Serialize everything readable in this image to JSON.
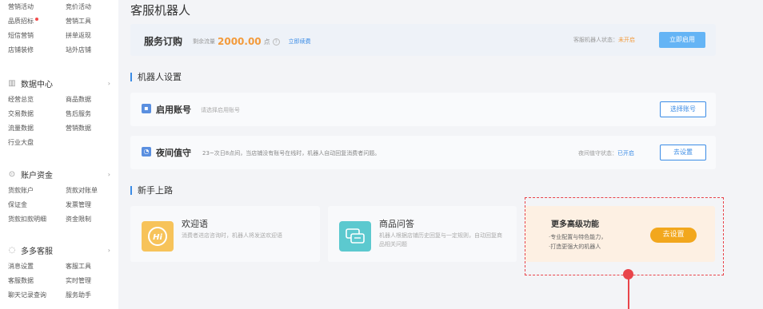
{
  "sidebar": {
    "top_items": [
      "营销活动",
      "竞价活动",
      "品质招标",
      "营销工具",
      "短信营销",
      "拼单返现",
      "店铺装修",
      "站外店铺"
    ],
    "sections": [
      {
        "title": "数据中心",
        "items": [
          "经营总览",
          "商品数据",
          "交易数据",
          "售后服务",
          "流量数据",
          "营销数据",
          "行业大盘",
          ""
        ]
      },
      {
        "title": "账户资金",
        "items": [
          "货款账户",
          "货款对账单",
          "保证金",
          "发票管理",
          "货款扣款明细",
          "资金限制"
        ]
      },
      {
        "title": "多多客服",
        "items": [
          "消息设置",
          "客服工具",
          "客服数据",
          "实时管理",
          "聊天记录查询",
          "服务助手"
        ]
      }
    ]
  },
  "page_title": "客服机器人",
  "subscription": {
    "label": "服务订购",
    "remaining_label": "剩余流量",
    "amount": "2000.00",
    "unit": "点",
    "renew_link": "立即续费",
    "status_label": "客服机器人状态：",
    "status_value": "未开启",
    "enable_button": "立即启用"
  },
  "robot_settings": {
    "heading": "机器人设置",
    "account": {
      "title": "启用账号",
      "hint": "请选择启用账号",
      "button": "选择账号"
    },
    "night_shift": {
      "title": "夜间值守",
      "desc": "23~次日8点间，当店铺没有账号在线时，机器人自动回复消费者问题。",
      "status_label": "夜间值守状态：",
      "status_value": "已开启",
      "button": "去设置"
    }
  },
  "onboarding": {
    "heading": "新手上路",
    "cards": [
      {
        "title": "欢迎语",
        "desc": "消费者进店咨询时，机器人将发送欢迎语",
        "icon": "hi-chat-icon"
      },
      {
        "title": "商品问答",
        "desc": "机器人根据店铺历史回复与一定规则，自动回复商品相关问题",
        "icon": "chat-bubbles-icon"
      }
    ],
    "advanced": {
      "title": "更多高级功能",
      "lines": [
        "·专业配置与特色能力，",
        "·打造更强大的机器人"
      ],
      "button": "去设置"
    }
  },
  "colors": {
    "accent": "#3b8ce6",
    "warning": "#f39a3a",
    "highlight": "#e9444a",
    "cta": "#f2a71d"
  }
}
